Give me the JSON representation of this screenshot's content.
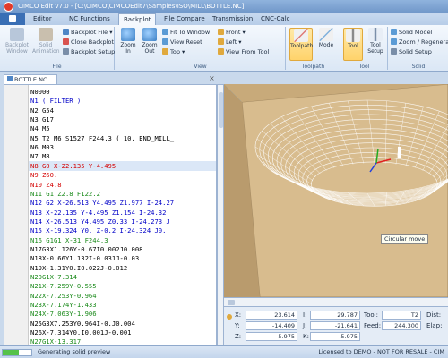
{
  "window": {
    "title": "CIMCO Edit v7.0 - [C:\\CIMCO\\CIMCOEdit7\\Samples\\ISO\\MILL\\BOTTLE.NC]"
  },
  "menu": {
    "file": "",
    "tabs": [
      "Editor",
      "NC Functions",
      "Backplot",
      "File Compare",
      "Transmission",
      "CNC-Calc"
    ],
    "active": "Backplot"
  },
  "ribbon": {
    "file_group": {
      "label": "File",
      "backplot_window": "Backplot Window",
      "solid_animation": "Solid Animation",
      "backplot_file": "Backplot File",
      "close_backplot": "Close Backplot",
      "backplot_setup": "Backplot Setup"
    },
    "view_group": {
      "label": "View",
      "zoom_in": "Zoom In",
      "zoom_out": "Zoom Out",
      "fit_to_window": "Fit To Window",
      "view_reset": "View Reset",
      "top": "Top",
      "front": "Front",
      "left": "Left",
      "view_from_tool": "View From Tool"
    },
    "toolpath_group": {
      "label": "Toolpath",
      "toolpath": "Toolpath",
      "mode": "Mode"
    },
    "tool_group": {
      "label": "Tool",
      "tool": "Tool",
      "tool_setup": "Tool Setup"
    },
    "solid_group": {
      "label": "Solid",
      "solid_model": "Solid Model",
      "zoom_regenerate": "Zoom / Regenerate",
      "solid_setup": "Solid Setup"
    }
  },
  "document": {
    "tab": "BOTTLE.NC"
  },
  "editor_lines": [
    {
      "text": "N0000",
      "color": "#000000"
    },
    {
      "text": "N1 ( FILTER )",
      "color": "#0000c8"
    },
    {
      "text": "N2 G54",
      "color": "#000000"
    },
    {
      "text": "N3 G17",
      "color": "#000000"
    },
    {
      "text": "N4 M5",
      "color": "#000000"
    },
    {
      "text": "N5 T2 M6 S1527 F244.3 ( 10. END_MILL_",
      "color": "#000000"
    },
    {
      "text": "N6 M03",
      "color": "#000000"
    },
    {
      "text": "N7 M8",
      "color": "#000000"
    },
    {
      "text": "N8 G0 X-22.135 Y-4.495",
      "color": "#d40000"
    },
    {
      "text": "N9 Z60.",
      "color": "#d40000"
    },
    {
      "text": "N10 Z4.8",
      "color": "#d40000"
    },
    {
      "text": "N11 G1 Z2.8 F122.2",
      "color": "#1a8a1a"
    },
    {
      "text": "N12 G2 X-26.513 Y4.495 Z1.977 I-24.27",
      "color": "#0000c8"
    },
    {
      "text": "N13 X-22.135 Y-4.495 Z1.154 I-24.32",
      "color": "#0000c8"
    },
    {
      "text": "N14 X-26.513 Y4.495 Z0.33 I-24.273 J",
      "color": "#0000c8"
    },
    {
      "text": "N15 X-19.324 Y0. Z-0.2 I-24.324 J0.",
      "color": "#0000c8"
    },
    {
      "text": "N16 G1G1 X-31 F244.3",
      "color": "#1a8a1a"
    },
    {
      "text": "N17G3X1.126Y-0.67I0.002J0.008",
      "color": "#000000"
    },
    {
      "text": "N18X-0.66Y1.132I-0.031J-0.03",
      "color": "#000000"
    },
    {
      "text": "N19X-1.31Y0.I0.022J-0.012",
      "color": "#000000"
    },
    {
      "text": "N20G1X-7.314",
      "color": "#1a8a1a"
    },
    {
      "text": "N21X-7.259Y-0.555",
      "color": "#1a8a1a"
    },
    {
      "text": "N22X-7.253Y-0.964",
      "color": "#1a8a1a"
    },
    {
      "text": "N23X-7.174Y-1.433",
      "color": "#1a8a1a"
    },
    {
      "text": "N24X-7.063Y-1.906",
      "color": "#1a8a1a"
    },
    {
      "text": "N25G3X7.253Y0.964I-0.J0.004",
      "color": "#000000"
    },
    {
      "text": "N26X-7.314Y0.I0.001J-0.001",
      "color": "#000000"
    },
    {
      "text": "N27G1X-13.317",
      "color": "#1a8a1a"
    }
  ],
  "tooltip": {
    "text": "Circular move"
  },
  "readout": {
    "x_label": "X:",
    "x": "23.614",
    "y_label": "Y:",
    "y": "-14.409",
    "z_label": "Z:",
    "z": "-5.975",
    "i_label": "I:",
    "i": "29.787",
    "j_label": "J:",
    "j": "-21.641",
    "k_label": "K:",
    "k": "-5.975",
    "tool_label": "Tool:",
    "tool": "T2",
    "feed_label": "Feed:",
    "feed": "244.300",
    "dist_label": "Dist:",
    "elap_label": "Elap:"
  },
  "statusbar": {
    "message": "Generating solid preview",
    "progress": 0.55,
    "license": "Licensed to DEMO - NOT FOR RESALE - CIM"
  },
  "colors": {
    "accent": "#3a6fb5",
    "viewport_bg": "#55a9f5",
    "stock": "#d8bc8e",
    "toolpath": "#ffffff",
    "highlight_line": "#dbe7f7"
  }
}
